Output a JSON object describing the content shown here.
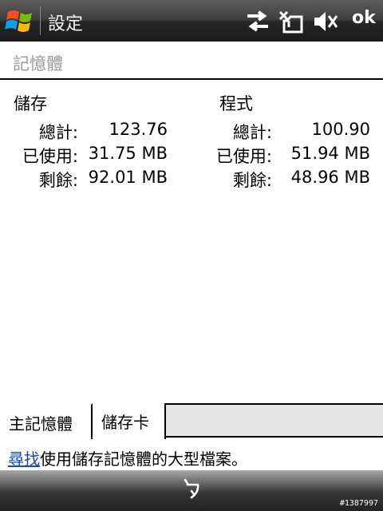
{
  "titlebar": {
    "title": "設定",
    "ok_label": "ok",
    "icons": [
      "windows-start-icon",
      "connectivity-icon",
      "no-sim-icon",
      "speaker-muted-icon"
    ]
  },
  "header": {
    "title": "記憶體"
  },
  "storage": {
    "title": "儲存",
    "total_label": "總計:",
    "total_value": "123.76",
    "used_label": "已使用:",
    "used_value": "31.75 MB",
    "free_label": "剩餘:",
    "free_value": "92.01 MB"
  },
  "program": {
    "title": "程式",
    "total_label": "總計:",
    "total_value": "100.90",
    "used_label": "已使用:",
    "used_value": "51.94 MB",
    "free_label": "剩餘:",
    "free_value": "48.96 MB"
  },
  "tabs": [
    {
      "label": "主記憶體",
      "active": true
    },
    {
      "label": "儲存卡",
      "active": false
    }
  ],
  "hint": {
    "link_text": "尋找",
    "text": "使用儲存記憶體的大型檔案。"
  },
  "watermark": "#1387997",
  "colors": {
    "link": "#1a48c4",
    "header_text": "#9a9a9a"
  }
}
